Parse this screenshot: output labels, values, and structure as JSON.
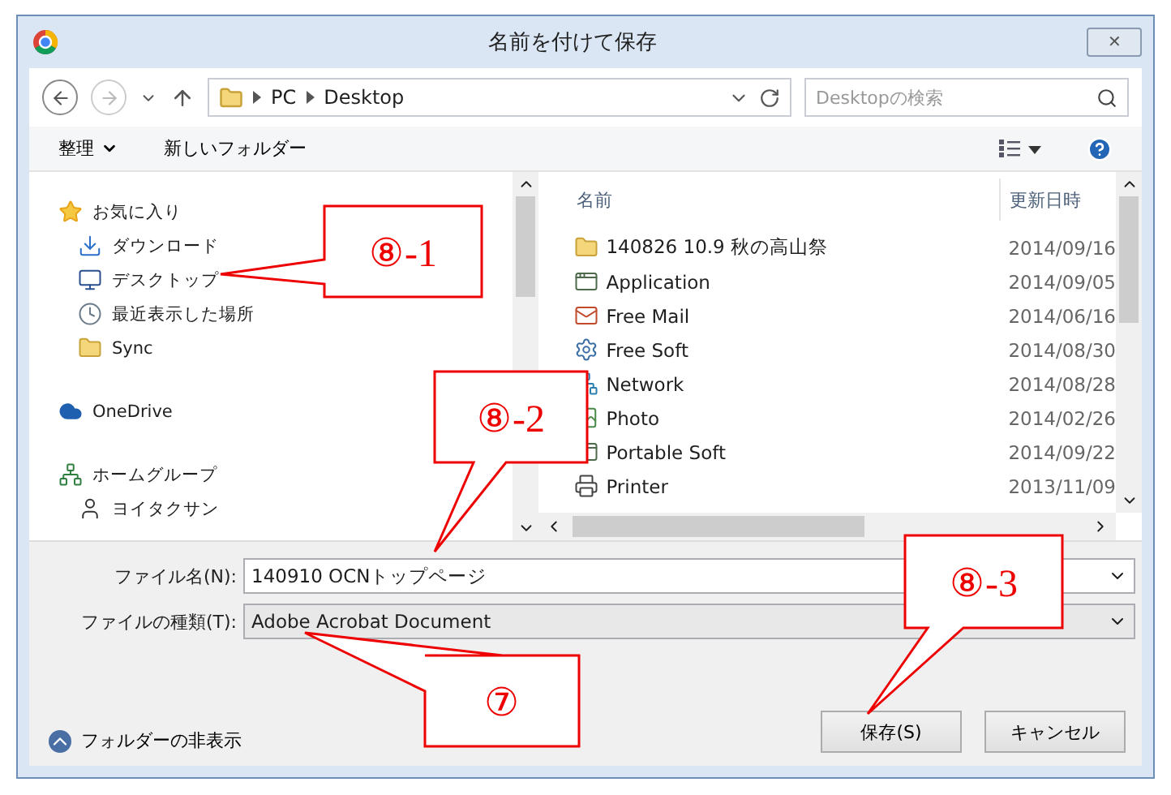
{
  "window": {
    "title": "名前を付けて保存",
    "close": "✕"
  },
  "address": {
    "path": [
      "PC",
      "Desktop"
    ],
    "search_placeholder": "Desktopの検索"
  },
  "toolbar": {
    "organize": "整理",
    "new_folder": "新しいフォルダー"
  },
  "nav": [
    {
      "label": "お気に入り",
      "kind": "star",
      "children": [
        {
          "label": "ダウンロード",
          "kind": "download"
        },
        {
          "label": "デスクトップ",
          "kind": "desktop"
        },
        {
          "label": "最近表示した場所",
          "kind": "recent"
        },
        {
          "label": "Sync",
          "kind": "folder"
        }
      ]
    },
    {
      "label": "OneDrive",
      "kind": "cloud"
    },
    {
      "label": "ホームグループ",
      "kind": "homegroup",
      "children": [
        {
          "label": "ヨイタクサン",
          "kind": "user"
        }
      ]
    }
  ],
  "files": {
    "columns": [
      "名前",
      "更新日時"
    ],
    "rows": [
      {
        "name": "140826 10.9 秋の高山祭",
        "date": "2014/09/16",
        "kind": "folder"
      },
      {
        "name": "Application",
        "date": "2014/09/05",
        "kind": "app"
      },
      {
        "name": "Free Mail",
        "date": "2014/06/16",
        "kind": "mail"
      },
      {
        "name": "Free Soft",
        "date": "2014/08/30",
        "kind": "soft"
      },
      {
        "name": "Network",
        "date": "2014/08/28",
        "kind": "network"
      },
      {
        "name": "Photo",
        "date": "2014/02/26",
        "kind": "photo"
      },
      {
        "name": "Portable Soft",
        "date": "2014/09/22",
        "kind": "app"
      },
      {
        "name": "Printer",
        "date": "2013/11/09",
        "kind": "printer"
      }
    ]
  },
  "filename": {
    "label": "ファイル名(N):",
    "value": "140910 OCNトップページ"
  },
  "filetype": {
    "label": "ファイルの種類(T):",
    "value": "Adobe Acrobat Document"
  },
  "hide_folders": "フォルダーの非表示",
  "buttons": [
    "保存(S)",
    "キャンセル"
  ],
  "callouts": [
    "⑧-1",
    "⑧-2",
    "⑧-3",
    "⑦"
  ]
}
